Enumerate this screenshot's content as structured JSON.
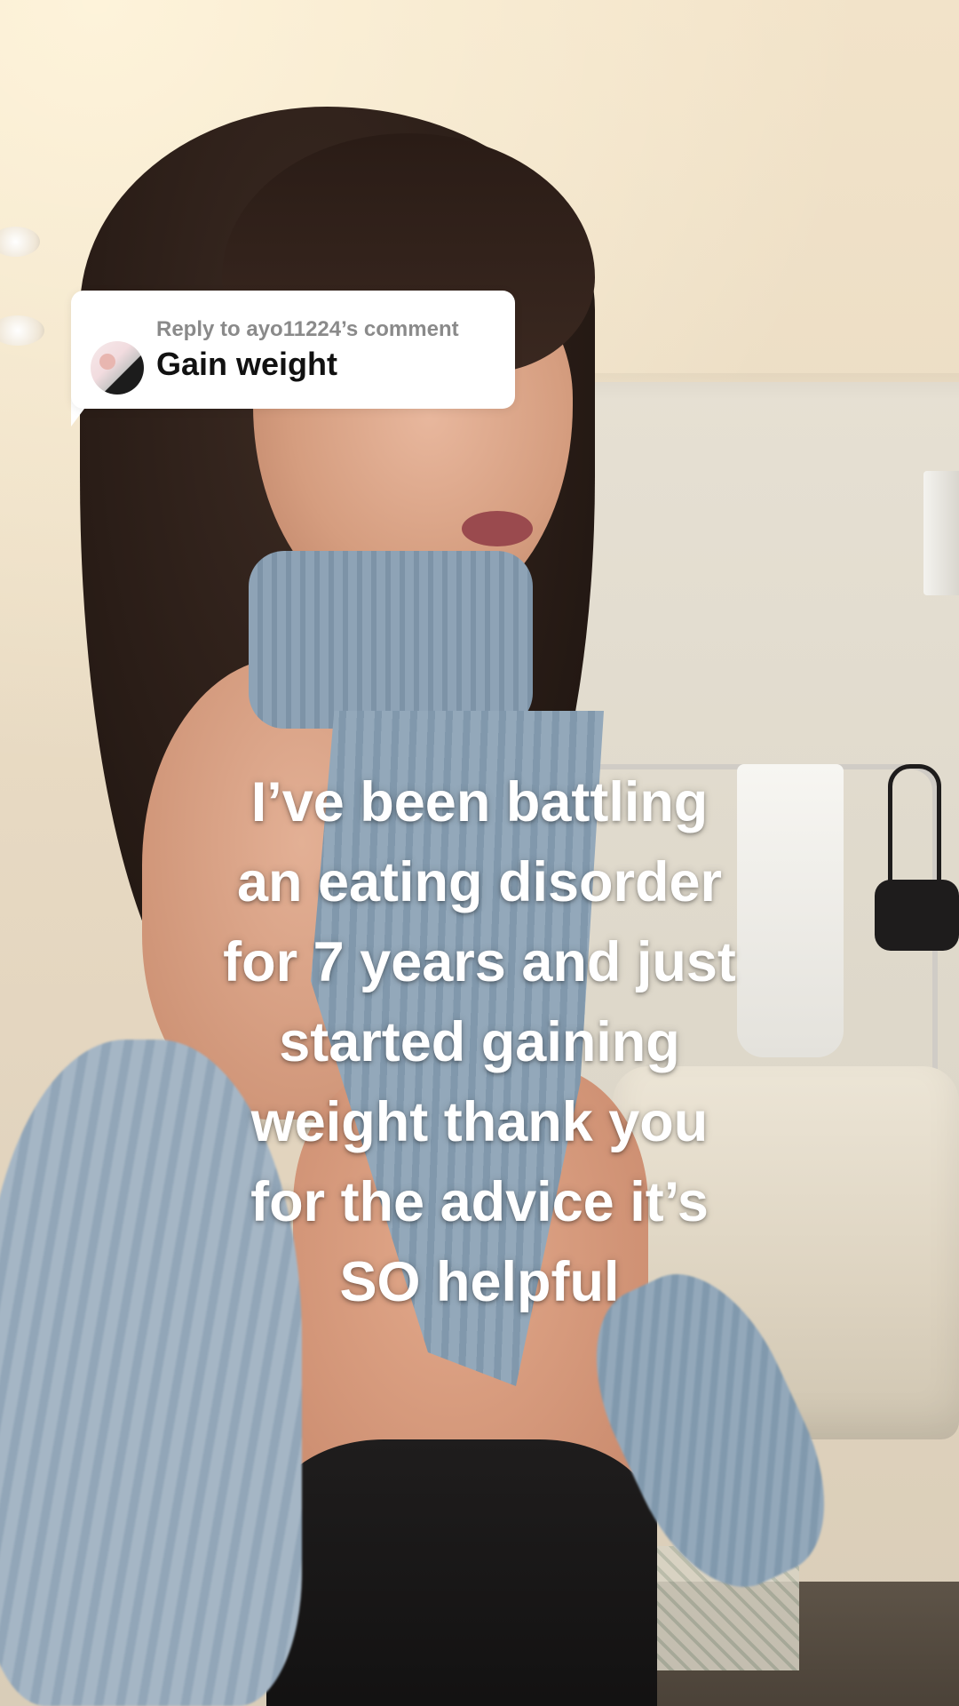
{
  "reply_card": {
    "header": "Reply to ayo11224’s comment",
    "comment": "Gain weight",
    "avatar_icon": "user-avatar"
  },
  "caption": {
    "lines": [
      "I’ve been battling",
      "an eating disorder",
      "for 7 years and just",
      "started gaining",
      "weight thank you",
      "for the advice it’s",
      "SO helpful"
    ]
  }
}
